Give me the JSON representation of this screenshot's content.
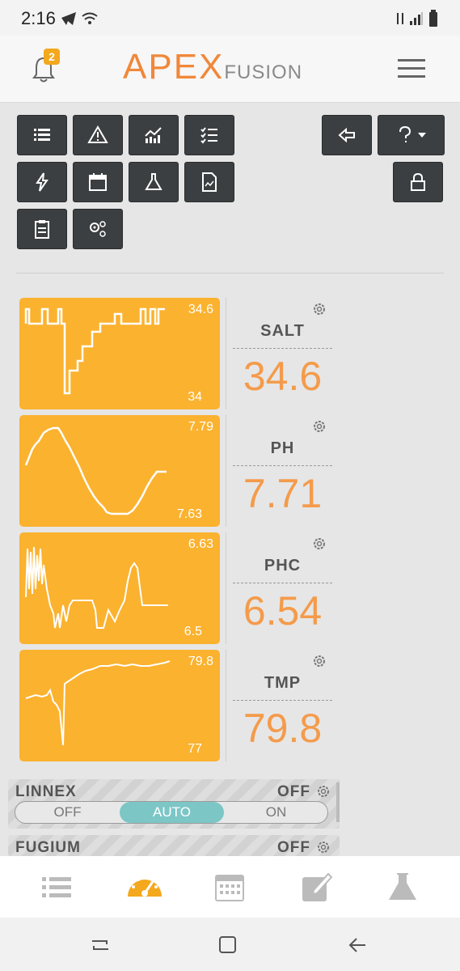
{
  "status_bar": {
    "time": "2:16"
  },
  "header": {
    "notification_count": "2",
    "logo_main": "APEX",
    "logo_sub": "FUSION"
  },
  "toolbar": {
    "buttons": [
      "list-icon",
      "alert-icon",
      "chart-icon",
      "checklist-icon",
      "power-icon",
      "calendar-icon",
      "flask-icon",
      "document-icon",
      "clipboard-icon",
      "settings-icon"
    ],
    "right_buttons": [
      "exit-icon",
      "help-icon",
      "lock-icon"
    ]
  },
  "probes": [
    {
      "name": "SALT",
      "value": "34.6",
      "max": "34.6",
      "min": "34"
    },
    {
      "name": "PH",
      "value": "7.71",
      "max": "7.79",
      "min": "7.63"
    },
    {
      "name": "PHC",
      "value": "6.54",
      "max": "6.63",
      "min": "6.5"
    },
    {
      "name": "TMP",
      "value": "79.8",
      "max": "79.8",
      "min": "77"
    }
  ],
  "outlets": [
    {
      "name": "LINNEX",
      "state": "OFF",
      "options": [
        "OFF",
        "AUTO",
        "ON"
      ],
      "selected": "AUTO"
    },
    {
      "name": "FUGIUM",
      "state": "OFF"
    }
  ],
  "bottom_nav": [
    "list-icon",
    "dashboard-icon",
    "calendar-icon",
    "edit-icon",
    "flask-icon"
  ],
  "colors": {
    "accent": "#f0883a",
    "tile": "#fbb22f",
    "value": "#f49b4b",
    "toggle": "#7cc6c6"
  }
}
